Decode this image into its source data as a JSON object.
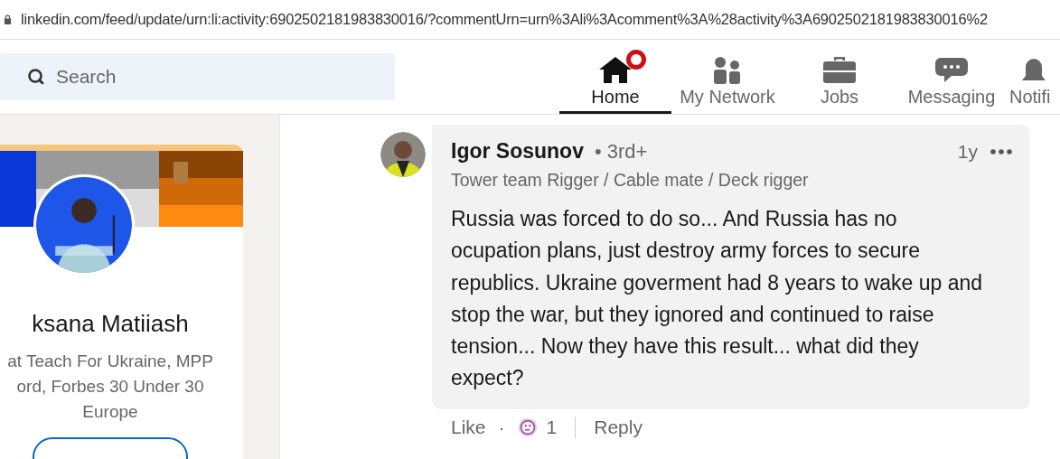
{
  "address_bar": {
    "url": "linkedin.com/feed/update/urn:li:activity:6902502181983830016/?commentUrn=urn%3Ali%3Acomment%3A%28activity%3A6902502181983830016%2"
  },
  "search": {
    "placeholder": "Search"
  },
  "nav": [
    {
      "label": "Home",
      "kind": "home",
      "selected": true,
      "badge": true
    },
    {
      "label": "My Network",
      "kind": "network",
      "selected": false,
      "badge": false
    },
    {
      "label": "Jobs",
      "kind": "jobs",
      "selected": false,
      "badge": false
    },
    {
      "label": "Messaging",
      "kind": "messaging",
      "selected": false,
      "badge": false
    },
    {
      "label": "Notifi",
      "kind": "notifications",
      "selected": false,
      "badge": false
    }
  ],
  "profile_card": {
    "name": "ksana Matiiash",
    "headline_lines": [
      "at Teach For Ukraine, MPP",
      "ord, Forbes 30 Under 30",
      "Europe"
    ]
  },
  "comment": {
    "author": "Igor Sosunov",
    "degree": "• 3rd+",
    "headline": "Tower team Rigger / Cable mate / Deck rigger",
    "time": "1y",
    "text": "Russia was forced to do so... And Russia has no ocupation plans, just destroy army forces to secure republics. Ukraine goverment had 8 years to wake up and stop the war, but they ignored and continued to raise tension... Now they have this result... what did they expect?",
    "like": "Like",
    "separator": "·",
    "reaction_count": "1",
    "reply": "Reply"
  }
}
